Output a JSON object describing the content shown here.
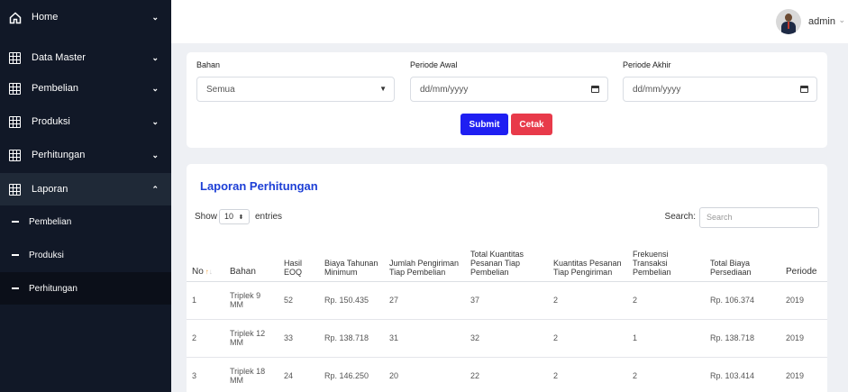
{
  "sidebar": {
    "items": [
      {
        "label": "Home",
        "icon": "home-icon",
        "chevron": "⌄"
      },
      {
        "label": "Data Master",
        "icon": "grid-icon",
        "chevron": "⌄"
      },
      {
        "label": "Pembelian",
        "icon": "grid-icon",
        "chevron": "⌄"
      },
      {
        "label": "Produksi",
        "icon": "grid-icon",
        "chevron": "⌄"
      },
      {
        "label": "Perhitungan",
        "icon": "grid-icon",
        "chevron": "⌄"
      },
      {
        "label": "Laporan",
        "icon": "grid-icon",
        "chevron": "⌃"
      }
    ],
    "subitems": [
      {
        "label": "Pembelian"
      },
      {
        "label": "Produksi"
      },
      {
        "label": "Perhitungan"
      }
    ],
    "colors": {
      "background": "#111827",
      "active": "#0b0f19"
    }
  },
  "header": {
    "user": "admin"
  },
  "filter": {
    "bahan_label": "Bahan",
    "bahan_value": "Semua",
    "periode_awal_label": "Periode Awal",
    "periode_awal_placeholder": "dd/mm/yyyy",
    "periode_akhir_label": "Periode Akhir",
    "periode_akhir_placeholder": "dd/mm/yyyy",
    "submit_label": "Submit",
    "cetak_label": "Cetak"
  },
  "report": {
    "title": "Laporan Perhitungan",
    "show_label": "Show",
    "page_size": "10",
    "entries_label": "entries",
    "search_label": "Search:",
    "search_placeholder": "Search",
    "columns": [
      "No",
      "Bahan",
      "Hasil EOQ",
      "Biaya Tahunan Minimum",
      "Jumlah Pengiriman Tiap Pembelian",
      "Total Kuantitas Pesanan Tiap Pembelian",
      "Kuantitas Pesanan Tiap Pengiriman",
      "Frekuensi Transaksi Pembelian",
      "Total Biaya Persediaan",
      "Periode"
    ],
    "rows": [
      [
        "1",
        "Triplek 9 MM",
        "52",
        "Rp. 150.435",
        "27",
        "37",
        "2",
        "2",
        "Rp. 106.374",
        "2019"
      ],
      [
        "2",
        "Triplek 12 MM",
        "33",
        "Rp. 138.718",
        "31",
        "32",
        "2",
        "1",
        "Rp. 138.718",
        "2019"
      ],
      [
        "3",
        "Triplek 18 MM",
        "24",
        "Rp. 146.250",
        "20",
        "22",
        "2",
        "2",
        "Rp. 103.414",
        "2019"
      ]
    ]
  },
  "colors": {
    "accent": "#1d3fd6",
    "submit": "#1f1ff2",
    "cetak": "#e83a4a"
  }
}
